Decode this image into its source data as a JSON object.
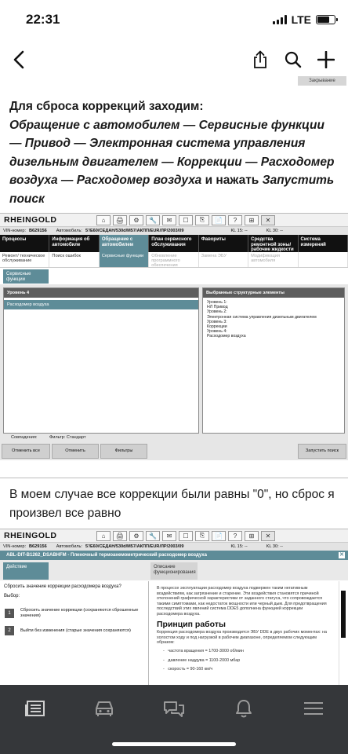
{
  "status_bar": {
    "time": "22:31",
    "network": "LTE"
  },
  "nav": {
    "back_icon": "chevron-left-icon",
    "share_icon": "share-icon",
    "search_icon": "search-icon",
    "add_icon": "plus-icon"
  },
  "closing_chip": "Закрывание",
  "paragraph1": {
    "lead": "Для сброса коррекций заходим:",
    "path": "Обращение с автомобилем — Сервисные функции — Привод — Электронная система управления дизельным двигателем — Коррекции — Расходомер воздуха — Расходомер воздуха",
    "mid": " и нажать ",
    "action": "Запустить поиск"
  },
  "screenshot1": {
    "logo": "RHEINGOLD",
    "tools": [
      "⌂",
      "🖨",
      "⚙",
      "🔧",
      "✉",
      "☐",
      "⎘",
      "📄",
      "?",
      "⊞",
      "✕"
    ],
    "info": {
      "vin_label": "VIN-номер:",
      "vin": "B629156",
      "car_label": "Автомобиль:",
      "car": "5'/E60/СЕДАН/530d/M57/АКПП/EUR/ЛР/2003/09",
      "kl15": "KL 15:  --",
      "kl30": "KL 30:  --"
    },
    "menu": [
      "Процессы",
      "Информация об автомобиле",
      "Обращение с автомобилем",
      "План сервисного обслуживания",
      "Фавориты",
      "Средства ремонтной зоны/ рабочие жидкости",
      "Система измерений"
    ],
    "submenu": [
      "Ремонт/ техническое обслуживание",
      "Поиск ошибок",
      "Сервисные функции",
      "Обновление программного обеспечения",
      "Замена ЭБУ",
      "Модификация автомобиля",
      ""
    ],
    "tab": "Сервисные функции",
    "level_header": "Уровень 4",
    "level_item": "Расходомер воздуха",
    "struct_header": "Выбранные структурные элементы",
    "struct_lines": [
      "Уровень 1:",
      "НЛ Привод",
      "Уровень 2:",
      "Электронная система управления дизельным двигателем",
      "Уровень 3:",
      "Коррекции",
      "Уровень 4:",
      "Расходомер воздуха"
    ],
    "matches_label": "Совпадения:",
    "filter_label": "Фильтр:  Стандарт",
    "footer_buttons": [
      "Отменить все",
      "Отменить",
      "Фильтры",
      "Запустить поиск"
    ]
  },
  "paragraph2": "В моем случае все коррекции были равны \"0\", но сброс я произвел все равно",
  "screenshot2": {
    "logo": "RHEINGOLD",
    "info": {
      "vin_label": "VIN-номер:",
      "vin": "B629156",
      "car_label": "Автомобиль:",
      "car": "5'/E60/СЕДАН/530d/M57/АКПП/EUR/ЛР/2003/09",
      "kl15": "KL 15:  --",
      "kl30": "KL 30:  --"
    },
    "title": "ABL-DIT-B1262_DSABHFM  -  Пленочный термоанемометрический расходомер воздуха",
    "tabs": [
      "Действие",
      "Описание функционирования"
    ],
    "question": "Сбросить значение коррекции расходомера воздуха?",
    "choice_label": "Выбор:",
    "options": [
      {
        "num": "1",
        "text": "Сбросить значение коррекции (сохраняются сброшенные значения)"
      },
      {
        "num": "2",
        "text": "Выйти без изменения (старые значения сохраняются)"
      }
    ],
    "desc": "В процессе эксплуатации расходомер воздуха подвержен таким негативным воздействиям, как загрязнение и старение. Эти воздействия становятся причиной отклонений графической характеристики от заданного статуса, что сопровождается такими симптомами, как недостаток мощности или черный дым. Для предотвращения последствий этих явлений система DDE5 дополнена функцией коррекции расходомера воздуха.",
    "principle_title": "Принцип работы",
    "principle_text": "Коррекция расходомера воздуха производится ЭБУ DDE в двух рабочих моментах: на холостом ходу и под нагрузкой в рабочем диапазоне, определяемом следующим образом:",
    "bullets": [
      "частота вращения = 1700-3000 об/мин",
      "давление наддува = 1100-2000 мбар",
      "скорость = 90-160 км/ч"
    ]
  },
  "tabbar": [
    "feed-icon",
    "car-icon",
    "chat-icon",
    "notification-bell-icon",
    "menu-icon"
  ]
}
